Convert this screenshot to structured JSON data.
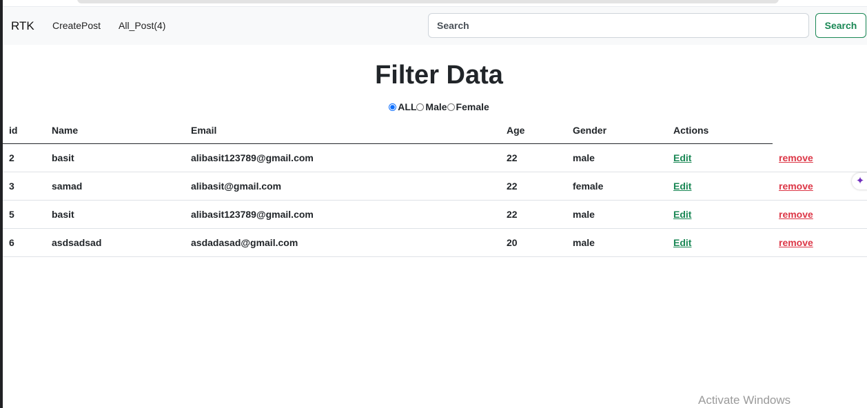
{
  "navbar": {
    "brand": "RTK",
    "links": [
      "CreatePost",
      "All_Post(4)"
    ],
    "search_placeholder": "Search",
    "search_button": "Search"
  },
  "page": {
    "title": "Filter Data",
    "filters": [
      {
        "label": "ALL",
        "checked": true
      },
      {
        "label": "Male",
        "checked": false
      },
      {
        "label": "Female",
        "checked": false
      }
    ]
  },
  "table": {
    "headers": [
      "id",
      "Name",
      "Email",
      "Age",
      "Gender",
      "Actions",
      ""
    ],
    "rows": [
      {
        "id": "2",
        "name": "basit",
        "email": "alibasit123789@gmail.com",
        "age": "22",
        "gender": "male",
        "edit": "Edit",
        "remove": "remove"
      },
      {
        "id": "3",
        "name": "samad",
        "email": "alibasit@gmail.com",
        "age": "22",
        "gender": "female",
        "edit": "Edit",
        "remove": "remove"
      },
      {
        "id": "5",
        "name": "basit",
        "email": "alibasit123789@gmail.com",
        "age": "22",
        "gender": "male",
        "edit": "Edit",
        "remove": "remove"
      },
      {
        "id": "6",
        "name": "asdsadsad",
        "email": "asdadasad@gmail.com",
        "age": "20",
        "gender": "male",
        "edit": "Edit",
        "remove": "remove"
      }
    ]
  },
  "side_widget": {
    "icon": "sparkle-icon",
    "glyph": "✦"
  },
  "watermark": "Activate Windows",
  "colors": {
    "navbar_bg": "#f8f9fa",
    "success": "#198754",
    "danger": "#dc3545",
    "radio_accent": "#0d6efd"
  }
}
